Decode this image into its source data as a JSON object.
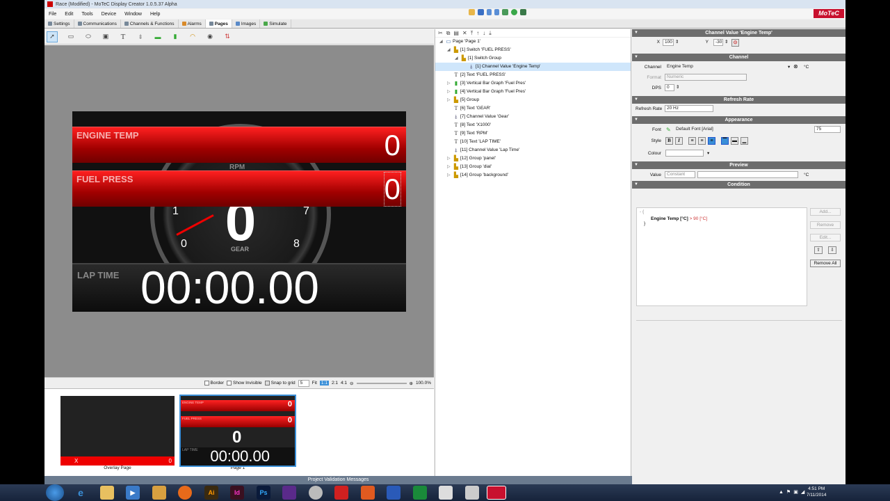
{
  "titlebar": {
    "title": "Race (Modified) - MoTeC Display Creator 1.0.5.37 Alpha"
  },
  "menu": [
    "File",
    "Edit",
    "Tools",
    "Device",
    "Window",
    "Help"
  ],
  "brand": "MoTeC",
  "tabs": [
    "Settings",
    "Communications",
    "Channels & Functions",
    "Alarms",
    "Pages",
    "Images",
    "Simulate"
  ],
  "display": {
    "engine_label": "ENGINE TEMP",
    "engine_value": "0",
    "fuel_label": "FUEL PRESS",
    "fuel_value": "0",
    "gear": "0",
    "gear_label": "GEAR",
    "rpm_label": "RPM",
    "rpm_nums": [
      "1",
      "0",
      "7",
      "8"
    ],
    "lap_label": "LAP TIME",
    "lap_value": "00:00.00"
  },
  "zoom": {
    "border": "Border",
    "show_invisible": "Show Invisible",
    "snap": "Snap to grid",
    "snap_value": "5",
    "fit": "Fit",
    "z1": "1:1",
    "z2": "2:1",
    "z4": "4:1",
    "percent": "100.0%"
  },
  "thumbs": {
    "overlay_caption": "Overlay Page",
    "overlay_x": "X",
    "overlay_zero": "0",
    "page_caption": "Page 1",
    "mini_engine": "ENGINE TEMP",
    "mini_fuel": "FUEL PRESS",
    "mini_val": "0",
    "mini_lap_label": "LAP TIME",
    "mini_lap": "00:00.00",
    "mini_gear": "0"
  },
  "validation": "Project Validation Messages",
  "tree": [
    {
      "t": "Page 'Page 1'",
      "d": 0,
      "exp": "◢"
    },
    {
      "t": "[1] Switch 'FUEL PRESS'",
      "d": 1,
      "exp": "◢"
    },
    {
      "t": "[1] Switch Group",
      "d": 2,
      "exp": "◢"
    },
    {
      "t": "[1] Channel Value 'Engine Temp'",
      "d": 3,
      "exp": "",
      "sel": true
    },
    {
      "t": "[2] Text 'FUEL PRESS'",
      "d": 1,
      "exp": ""
    },
    {
      "t": "[3] Vertical Bar Graph 'Fuel Pres'",
      "d": 1,
      "exp": "▷"
    },
    {
      "t": "[4] Vertical Bar Graph 'Fuel Pres'",
      "d": 1,
      "exp": "▷"
    },
    {
      "t": "[5] Group",
      "d": 1,
      "exp": "▷"
    },
    {
      "t": "[6] Text 'GEAR'",
      "d": 1,
      "exp": ""
    },
    {
      "t": "[7] Channel Value 'Gear'",
      "d": 1,
      "exp": ""
    },
    {
      "t": "[8] Text 'X1000'",
      "d": 1,
      "exp": ""
    },
    {
      "t": "[9] Text 'RPM'",
      "d": 1,
      "exp": ""
    },
    {
      "t": "[10] Text 'LAP TIME'",
      "d": 1,
      "exp": ""
    },
    {
      "t": "[11] Channel Value 'Lap Time'",
      "d": 1,
      "exp": ""
    },
    {
      "t": "[12] Group 'panel'",
      "d": 1,
      "exp": "▷"
    },
    {
      "t": "[13] Group 'dial'",
      "d": 1,
      "exp": "▷"
    },
    {
      "t": "[14] Group 'background'",
      "d": 1,
      "exp": "▷"
    }
  ],
  "props": {
    "header": "Channel Value 'Engine Temp'",
    "x_label": "X",
    "x_value": "100",
    "y_label": "Y",
    "y_value": "-30",
    "channel_section": "Channel",
    "channel_label": "Channel",
    "channel_value": "Engine Temp",
    "unit": "°C",
    "format_label": "Format",
    "format_value": "Numeric",
    "dps_label": "DPS",
    "dps_value": "0",
    "refresh_section": "Refresh Rate",
    "refresh_label": "Refresh Rate",
    "refresh_value": "20 Hz",
    "appearance_section": "Appearance",
    "font_label": "Font",
    "font_value": "Default Font [Arial]",
    "font_size": "75",
    "style_label": "Style",
    "bold": "B",
    "italic": "I",
    "colour_label": "Colour",
    "preview_section": "Preview",
    "value_label": "Value",
    "value_mode": "Constant",
    "preview_unit": "°C",
    "condition_section": "Condition",
    "cond_open": "- {",
    "cond_channel": "Engine Temp [°C]",
    "cond_op": "> 90 [°C]",
    "cond_close": "}",
    "btn_add": "Add...",
    "btn_remove": "Remove",
    "btn_edit": "Edit...",
    "btn_remove_all": "Remove All"
  },
  "clock": {
    "time": "4:51 PM",
    "date": "7/11/2014"
  },
  "taskbar_apps": [
    "Ai",
    "Id",
    "Ps"
  ]
}
